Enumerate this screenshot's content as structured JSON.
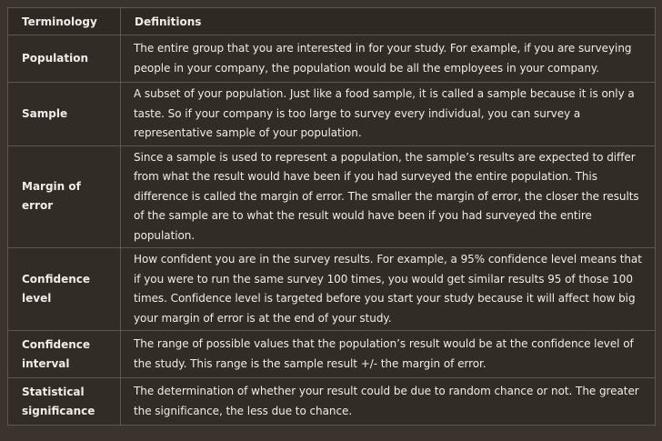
{
  "table": {
    "headers": [
      "Terminology",
      "Definitions"
    ],
    "rows": [
      {
        "term": "Population",
        "definition": "The entire group that you are interested in for your study. For example, if you are surveying people in your company, the population would be all the employees in your company."
      },
      {
        "term": "Sample",
        "definition": "A subset of your population. Just like a food sample, it is called a sample because it is only a taste. So if your company is too large to survey every individual, you can survey a representative sample of your population."
      },
      {
        "term": "Margin of error",
        "definition": "Since a sample is used to represent a population, the sample’s results are expected to differ from what the result would have been if you had surveyed the entire population. This difference is called the margin of error. The smaller the margin of error, the closer the results of the sample are to what the result would have been if you had surveyed the entire population."
      },
      {
        "term": "Confidence level",
        "definition": "How confident you are in the survey results. For example, a 95% confidence level means that if you were to run the same survey 100 times, you would get similar results 95 of those 100 times. Confidence level is targeted before you start your study because it will affect how big your margin of error is at the end of your study."
      },
      {
        "term": "Confidence interval",
        "definition": "The range of possible values that the population’s result would be at the confidence level of the study. This range is the sample result +/- the margin of error."
      },
      {
        "term": "Statistical significance",
        "definition": "The determination of whether your result could be due to random chance or not. The greater the significance, the less due to chance."
      }
    ]
  }
}
